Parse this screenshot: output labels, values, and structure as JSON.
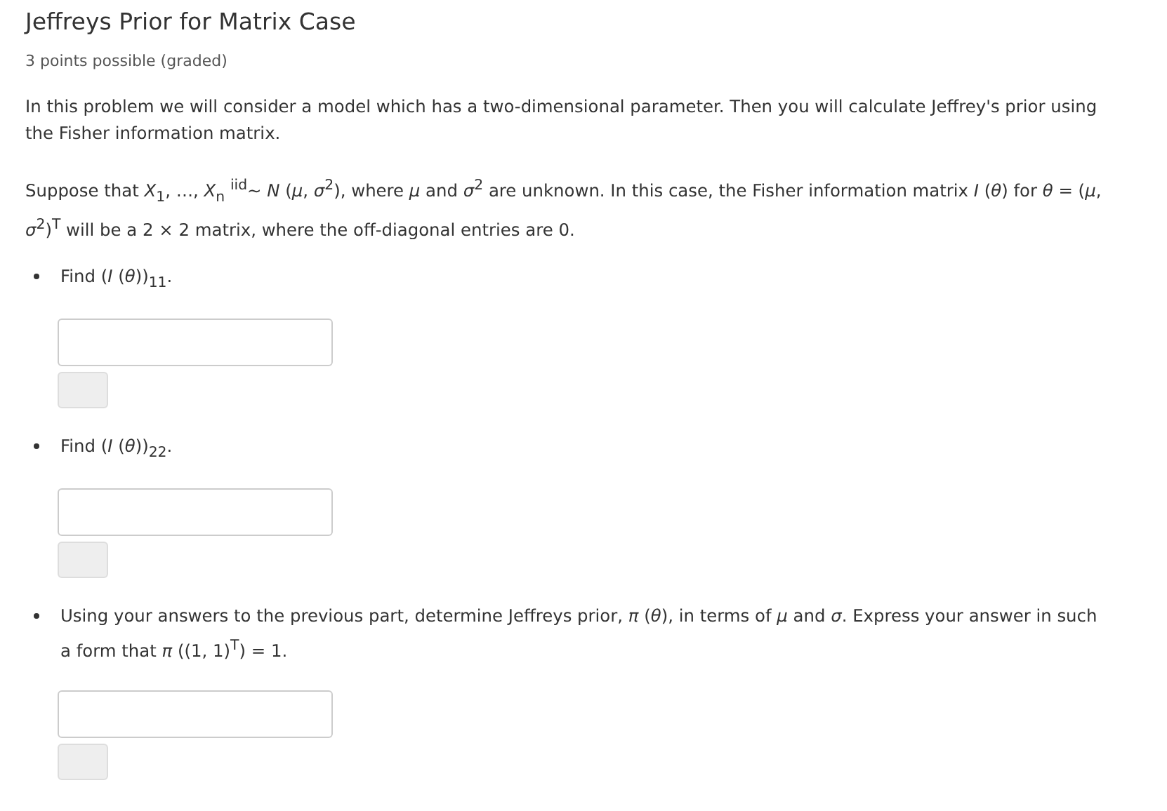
{
  "title": "Jeffreys Prior for Matrix Case",
  "points": "3 points possible (graded)",
  "intro": "In this problem we will consider a model which has a two-dimensional parameter. Then you will calculate Jeffrey's prior using the Fisher information matrix.",
  "setup": "Suppose that *X*$_{1}$, …, *X*$_{n}$ $^{iid}$∼ *N* (*μ*, *σ*$^{2}$), where *μ* and *σ*$^{2}$ are unknown. In this case, the Fisher information matrix *I* (*θ*) for *θ* = (*μ*, *σ*$^{2}$)$^{T}$ will be a 2 × 2 matrix, where the off-diagonal entries are 0.",
  "questions": [
    {
      "prompt": "Find (*I* (*θ*))$_{11}$."
    },
    {
      "prompt": "Find (*I* (*θ*))$_{22}$."
    },
    {
      "prompt": "Using your answers to the previous part, determine Jeffreys prior, *π* (*θ*), in terms of *μ* and *σ*. Express your answer in such a form that *π* ((1, 1)$^{T}$) = 1."
    }
  ]
}
